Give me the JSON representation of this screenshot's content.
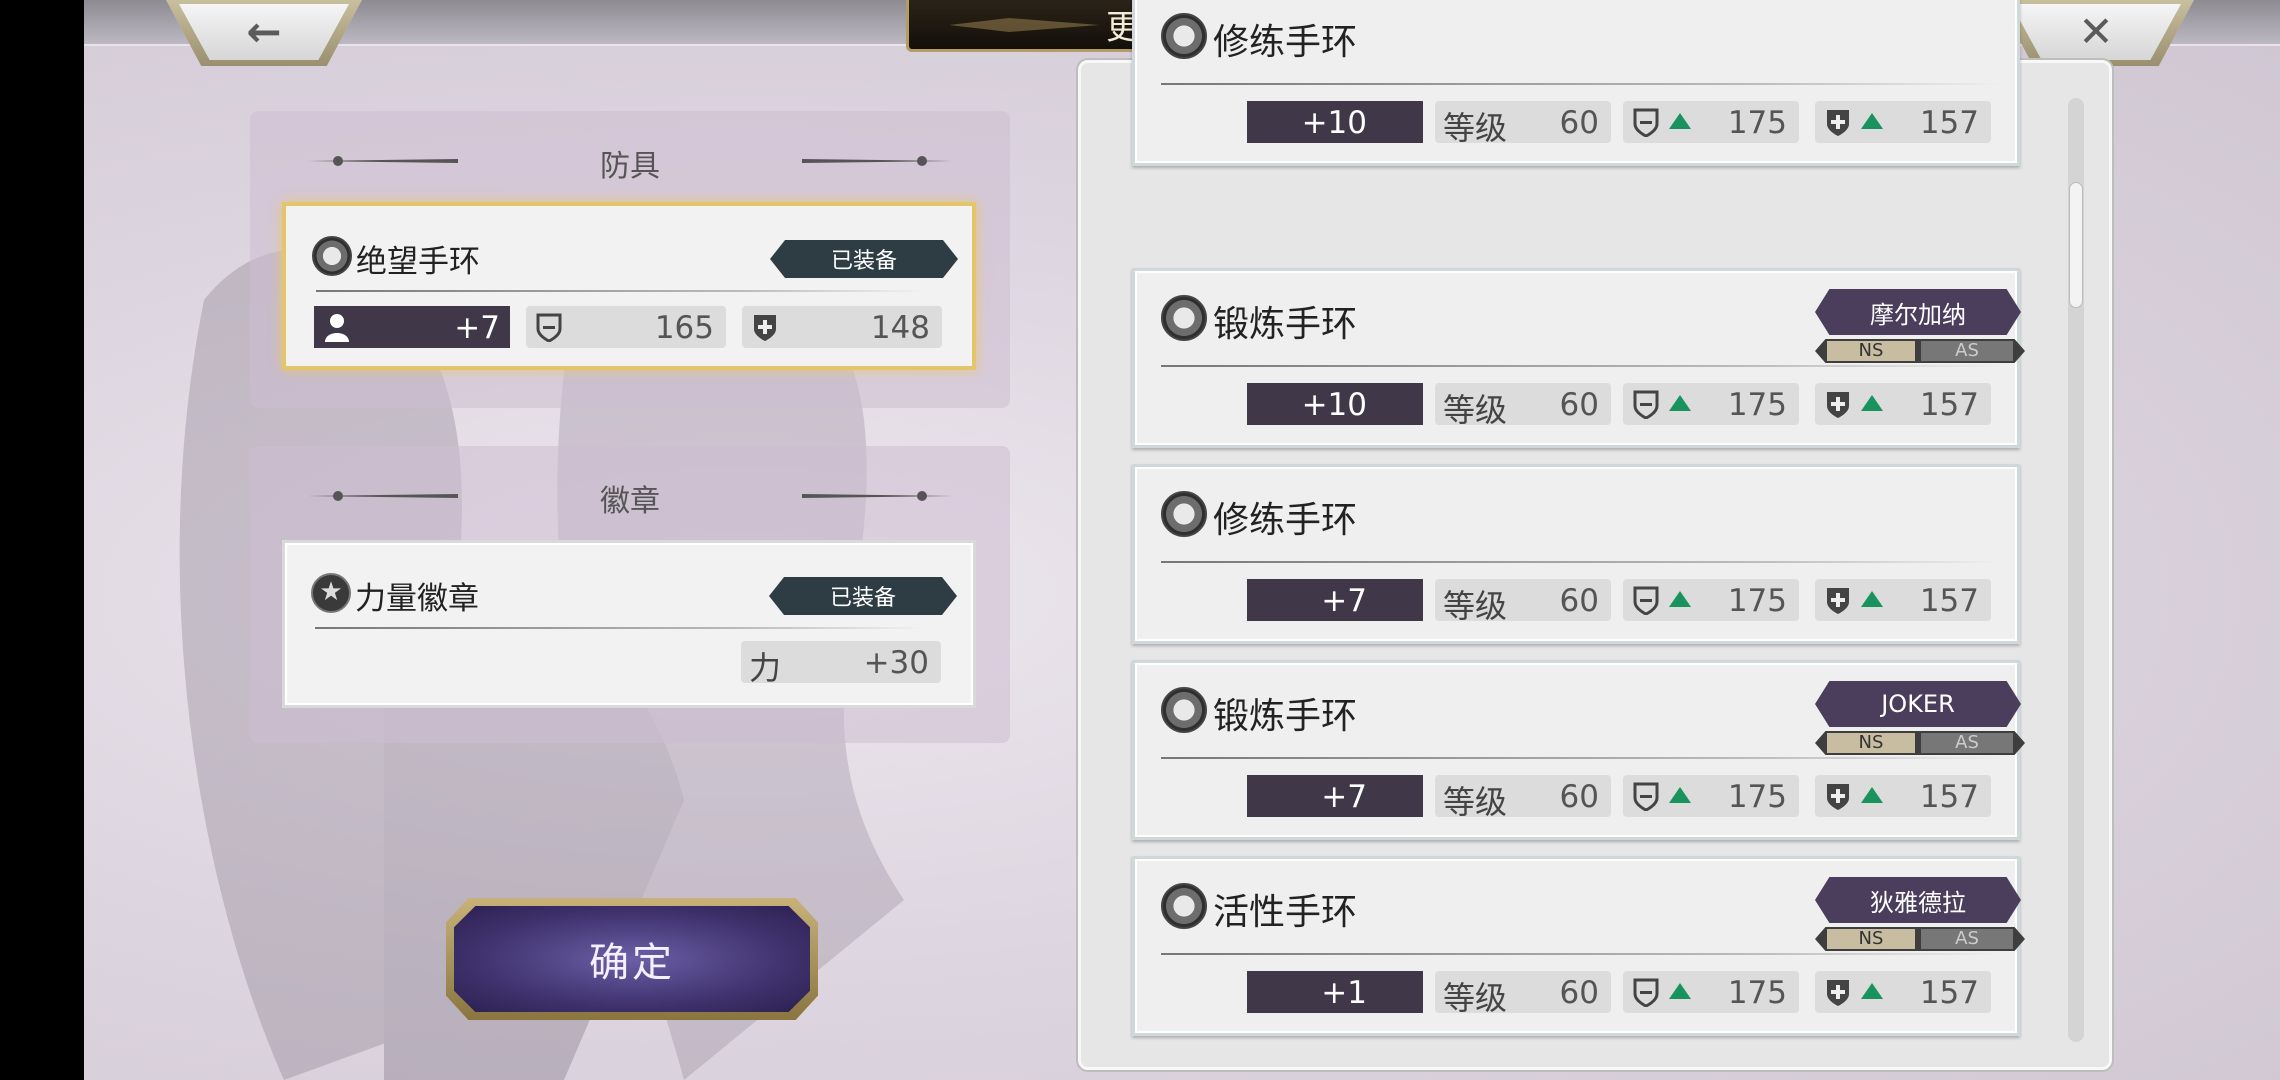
{
  "header": {
    "title": "更换装备",
    "back_glyph": "←",
    "close_glyph": "✕"
  },
  "armor": {
    "section_title": "防具",
    "card": {
      "name": "绝望手环",
      "status": "已装备",
      "level": "+7",
      "def_phys": "165",
      "def_mag": "148"
    }
  },
  "badge": {
    "section_title": "徽章",
    "card": {
      "name": "力量徽章",
      "status": "已装备",
      "stat_label": "力",
      "stat_value": "+30"
    }
  },
  "confirm_label": "确定",
  "list": {
    "grade_label": "等级",
    "items": [
      {
        "name": "修练手环",
        "level": "+10",
        "grade": "60",
        "def_phys": "175",
        "def_mag": "157",
        "owner": "",
        "ns": "",
        "as": ""
      },
      {
        "name": "锻炼手环",
        "level": "+10",
        "grade": "60",
        "def_phys": "175",
        "def_mag": "157",
        "owner": "摩尔加纳",
        "ns": "NS",
        "as": "AS"
      },
      {
        "name": "修练手环",
        "level": "+7",
        "grade": "60",
        "def_phys": "175",
        "def_mag": "157",
        "owner": "",
        "ns": "",
        "as": ""
      },
      {
        "name": "锻炼手环",
        "level": "+7",
        "grade": "60",
        "def_phys": "175",
        "def_mag": "157",
        "owner": "JOKER",
        "ns": "NS",
        "as": "AS"
      },
      {
        "name": "活性手环",
        "level": "+1",
        "grade": "60",
        "def_phys": "175",
        "def_mag": "157",
        "owner": "狄雅德拉",
        "ns": "NS",
        "as": "AS"
      }
    ]
  },
  "icons": {
    "equip": "ring-icon",
    "badge": "badge-icon",
    "phys": "shield-icon",
    "mag": "cross-shield-icon",
    "up": "up-arrow-icon",
    "user": "person-icon"
  },
  "colors": {
    "gold": "#e3c56c",
    "level_bg": "#403748",
    "tag_bg": "#2e3d44",
    "owner_bg": "#4b3e5c",
    "up_arrow": "#19925d"
  }
}
